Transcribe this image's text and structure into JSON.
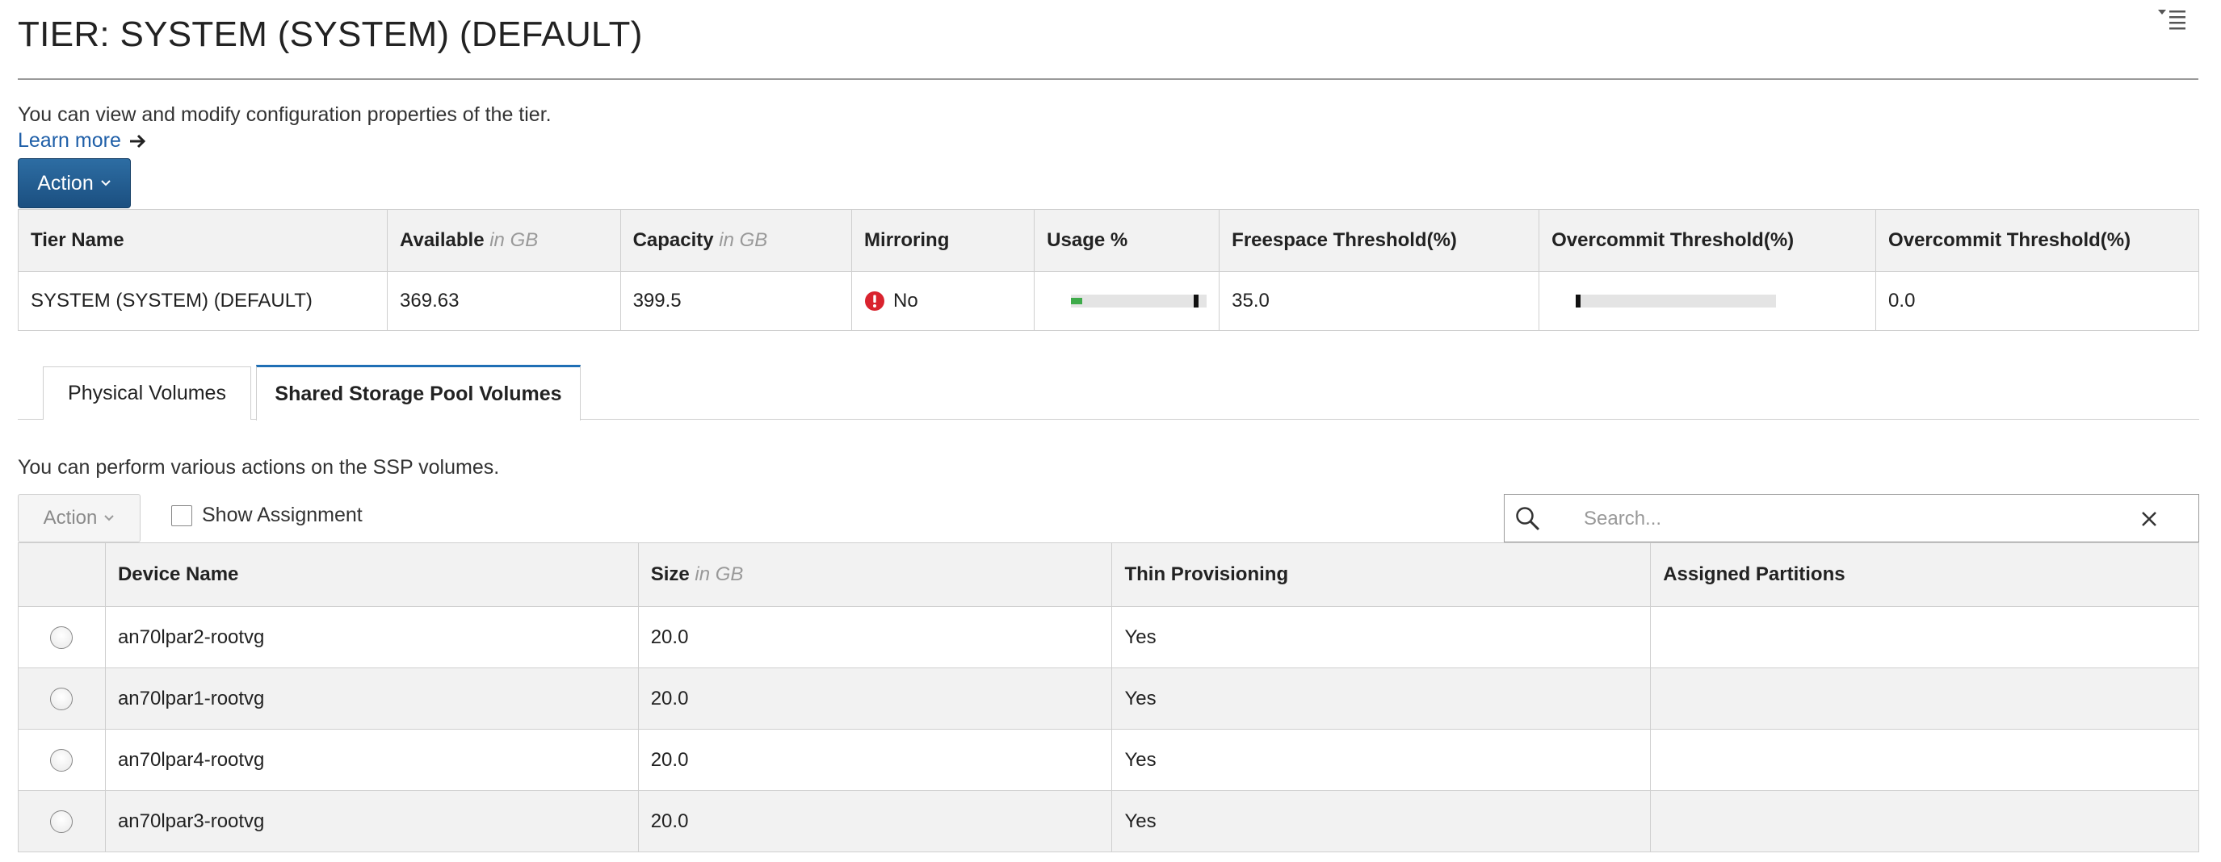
{
  "page": {
    "title": "TIER: SYSTEM (SYSTEM) (DEFAULT)",
    "description": "You can view and modify configuration properties of the tier.",
    "learn_more": "Learn more",
    "action_label": "Action"
  },
  "tier_table": {
    "headers": {
      "name": "Tier Name",
      "available": "Available",
      "capacity": "Capacity",
      "unit": "in GB",
      "mirroring": "Mirroring",
      "usage": "Usage %",
      "freespace": "Freespace Threshold(%)",
      "overcommit1": "Overcommit Threshold(%)",
      "overcommit2": "Overcommit Threshold(%)"
    },
    "row": {
      "name": "SYSTEM (SYSTEM) (DEFAULT)",
      "available": "369.63",
      "capacity": "399.5",
      "mirroring": "No",
      "usage_fraction": 0.075,
      "freespace": "35.0",
      "overcommit2": "0.0"
    }
  },
  "tabs": [
    "Physical Volumes",
    "Shared Storage Pool Volumes"
  ],
  "active_tab": "Shared Storage Pool Volumes",
  "ssp": {
    "description": "You can perform various actions on the SSP volumes.",
    "action_label": "Action",
    "show_assignment": "Show Assignment",
    "search_placeholder": "Search...",
    "headers": {
      "device": "Device Name",
      "size": "Size",
      "unit": "in GB",
      "thin": "Thin Provisioning",
      "assigned": "Assigned Partitions"
    },
    "rows": [
      {
        "device": "an70lpar2-rootvg",
        "size": "20.0",
        "thin": "Yes",
        "assigned": ""
      },
      {
        "device": "an70lpar1-rootvg",
        "size": "20.0",
        "thin": "Yes",
        "assigned": ""
      },
      {
        "device": "an70lpar4-rootvg",
        "size": "20.0",
        "thin": "Yes",
        "assigned": ""
      },
      {
        "device": "an70lpar3-rootvg",
        "size": "20.0",
        "thin": "Yes",
        "assigned": ""
      }
    ]
  },
  "colors": {
    "accent": "#1f5fa8",
    "primary_button": "#2d6da3",
    "error": "#d9232e",
    "usage_fill": "#3eab4a"
  },
  "icons": {
    "menu": "menu-dropdown-icon",
    "learn_more": "arrow-right-icon",
    "action": "chevron-down-icon",
    "mirroring": "error-icon",
    "search": "search-icon",
    "clear": "close-icon"
  }
}
